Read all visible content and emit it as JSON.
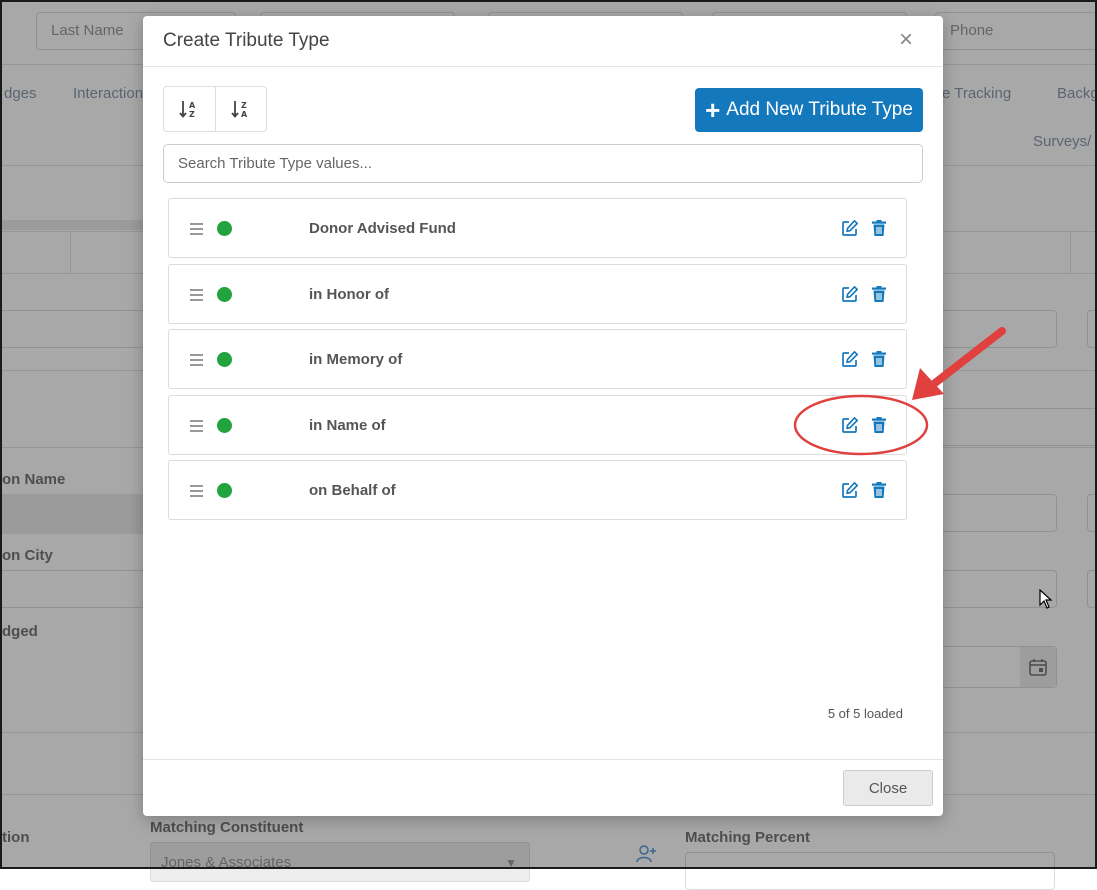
{
  "background": {
    "filters": {
      "last_name": "Last Name",
      "phone": "Phone"
    },
    "tabs": [
      "dges",
      "Interaction",
      "e Tracking",
      "Backg",
      "Surveys/"
    ],
    "labels": [
      "on Name",
      "on City",
      "dged",
      "tion",
      "Matching Constituent",
      "Matching Percent"
    ],
    "matching_constituent_value": "Jones & Associates"
  },
  "modal": {
    "title": "Create Tribute Type",
    "close_x": "×",
    "sort_asc_icon": "sort-alpha-down-icon",
    "sort_desc_icon": "sort-alpha-up-icon",
    "add_button_label": "Add New Tribute Type",
    "search_placeholder": "Search Tribute Type values...",
    "items": [
      {
        "label": "Donor Advised Fund",
        "active": true
      },
      {
        "label": "in Honor of",
        "active": true
      },
      {
        "label": "in Memory of",
        "active": true
      },
      {
        "label": "in Name of",
        "active": true
      },
      {
        "label": "on Behalf of",
        "active": true
      }
    ],
    "loaded_text": "5 of 5 loaded",
    "close_label": "Close"
  },
  "colors": {
    "accent": "#1478bd",
    "active_dot": "#22a33e",
    "annotation": "#e0413f"
  }
}
